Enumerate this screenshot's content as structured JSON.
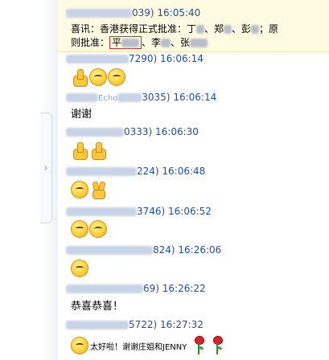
{
  "sidebar": {
    "collapse_glyph": "›"
  },
  "messages": [
    {
      "header_time": "039) 16:05:40",
      "body_line1": "喜讯：香港获得正式批准：丁",
      "body_sep1": "、郑",
      "body_sep2": "、彭",
      "body_sep3": "；原",
      "body_line2a": "则批准：",
      "body_boxed": "平",
      "body_sep4": "、李",
      "body_sep5": "、张"
    },
    {
      "header_time": "7290) 16:06:14",
      "emojis": [
        "thumbs-up",
        "giggle-face",
        "giggle-face"
      ]
    },
    {
      "header_mid": "Echo",
      "header_time": "3035) 16:06:14",
      "text": "谢谢"
    },
    {
      "header_time": "0333) 16:06:30",
      "emojis": [
        "thumbs-up",
        "thumbs-up"
      ]
    },
    {
      "header_time": "224) 16:06:48",
      "emojis": [
        "giggle-face",
        "victory-hand"
      ]
    },
    {
      "header_time": "3746) 16:06:52",
      "emojis": [
        "giggle-face",
        "giggle-face"
      ]
    },
    {
      "header_time": "824) 16:26:06",
      "emojis": [
        "giggle-face"
      ]
    },
    {
      "header_time": "69) 16:26:22",
      "text": "恭喜恭喜！"
    },
    {
      "header_time": "5722) 16:27:32",
      "text": "太好啦！谢谢庄姐和JENNY",
      "emojis_after": [
        "rose",
        "rose"
      ]
    }
  ]
}
